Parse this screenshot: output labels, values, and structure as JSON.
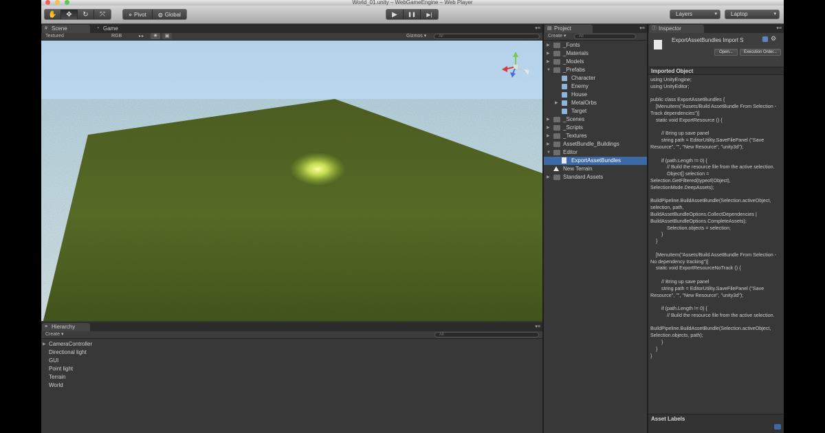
{
  "window": {
    "title": "World_01.unity – WebGameEngine – Web Player"
  },
  "toolbar": {
    "tools": [
      "hand-tool",
      "move-tool",
      "rotate-tool",
      "scale-tool"
    ],
    "pivot_label": "Pivot",
    "global_label": "Global",
    "play_icon": "▶",
    "pause_icon": "❚❚",
    "step_icon": "▶|",
    "layers_label": "Layers",
    "layout_label": "Laptop"
  },
  "scene": {
    "tabs": [
      {
        "label": "Scene"
      },
      {
        "label": "Game"
      }
    ],
    "render_mode": "Textured",
    "color_mode": "RGB",
    "gizmos_label": "Gizmos ▾",
    "search_placeholder": "All"
  },
  "hierarchy": {
    "tab": "Hierarchy",
    "create_label": "Create ▾",
    "search_placeholder": "All",
    "items": [
      "CameraController",
      "Directional light",
      "GUI",
      "Point light",
      "Terrain",
      "World"
    ]
  },
  "project": {
    "tab": "Project",
    "create_label": "Create ▾",
    "search_placeholder": "All",
    "items": [
      {
        "label": "_Fonts",
        "type": "folder",
        "depth": 0,
        "expanded": false,
        "selected": false
      },
      {
        "label": "_Materials",
        "type": "folder",
        "depth": 0,
        "expanded": false,
        "selected": false
      },
      {
        "label": "_Models",
        "type": "folder",
        "depth": 0,
        "expanded": false,
        "selected": false
      },
      {
        "label": "_Prefabs",
        "type": "folder",
        "depth": 0,
        "expanded": true,
        "selected": false
      },
      {
        "label": "Character",
        "type": "prefab",
        "depth": 1,
        "expanded": null,
        "selected": false
      },
      {
        "label": "Enemy",
        "type": "prefab",
        "depth": 1,
        "expanded": null,
        "selected": false
      },
      {
        "label": "House",
        "type": "prefab",
        "depth": 1,
        "expanded": null,
        "selected": false
      },
      {
        "label": "MetalOrbs",
        "type": "prefab",
        "depth": 1,
        "expanded": false,
        "selected": false
      },
      {
        "label": "Target",
        "type": "prefab",
        "depth": 1,
        "expanded": null,
        "selected": false
      },
      {
        "label": "_Scenes",
        "type": "folder",
        "depth": 0,
        "expanded": false,
        "selected": false
      },
      {
        "label": "_Scripts",
        "type": "folder",
        "depth": 0,
        "expanded": false,
        "selected": false
      },
      {
        "label": "_Textures",
        "type": "folder",
        "depth": 0,
        "expanded": false,
        "selected": false
      },
      {
        "label": "AssetBundle_Buildings",
        "type": "folder",
        "depth": 0,
        "expanded": false,
        "selected": false
      },
      {
        "label": "Editor",
        "type": "folder",
        "depth": 0,
        "expanded": true,
        "selected": false
      },
      {
        "label": "ExportAssetBundles",
        "type": "script",
        "depth": 1,
        "expanded": null,
        "selected": true
      },
      {
        "label": "New Terrain",
        "type": "terrain",
        "depth": 0,
        "expanded": null,
        "selected": false
      },
      {
        "label": "Standard Assets",
        "type": "folder",
        "depth": 0,
        "expanded": false,
        "selected": false
      }
    ]
  },
  "inspector": {
    "tab": "Inspector",
    "asset_title": "ExportAssetBundles Import S",
    "open_label": "Open...",
    "execution_order_label": "Execution Order...",
    "imported_object_label": "Imported Object",
    "code": "using UnityEngine;\nusing UnityEditor;\n\npublic class ExportAssetBundles {\n    [MenuItem(\"Assets/Build AssetBundle From Selection - Track dependencies\")]\n    static void ExportResource () {\n\n        // Bring up save panel\n        string path = EditorUtility.SaveFilePanel (\"Save Resource\", \"\", \"New Resource\", \"unity3d\");\n\n        if (path.Length != 0) {\n            // Build the resource file from the active selection.\n            Object[] selection = Selection.GetFiltered(typeof(Object), SelectionMode.DeepAssets);\n\nBuildPipeline.BuildAssetBundle(Selection.activeObject, selection, path, BuildAssetBundleOptions.CollectDependencies | BuildAssetBundleOptions.CompleteAssets);\n            Selection.objects = selection;\n        }\n    }\n\n    [MenuItem(\"Assets/Build AssetBundle From Selection - No dependency tracking\")]\n    static void ExportResourceNoTrack () {\n\n        // Bring up save panel\n        string path = EditorUtility.SaveFilePanel (\"Save Resource\", \"\", \"New Resource\", \"unity3d\");\n\n        if (path.Length != 0) {\n            // Build the resource file from the active selection.\n\nBuildPipeline.BuildAssetBundle(Selection.activeObject, Selection.objects, path);\n        }\n    }\n}",
    "asset_labels_label": "Asset Labels"
  },
  "colors": {
    "selection": "#3d6aa5",
    "panel_bg": "#383838",
    "terrain": "#4c5e1e",
    "sky": "#c4dcef",
    "light": "#f4ff9c"
  }
}
